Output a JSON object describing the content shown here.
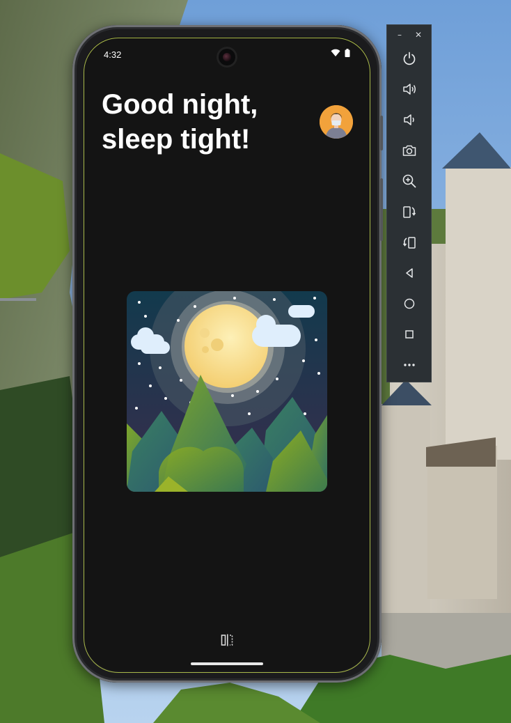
{
  "status_bar": {
    "time": "4:32",
    "icons": [
      "wifi-icon",
      "battery-icon"
    ]
  },
  "app": {
    "headline_line1": "Good night,",
    "headline_line2": "sleep tight!",
    "avatar": "user-avatar",
    "artwork": "night-moon-mountains-illustration"
  },
  "system_nav": {
    "icons": [
      "split-screen-icon"
    ]
  },
  "emulator_toolbar": {
    "minimize_label": "–",
    "close_label": "✕",
    "buttons": [
      "power-icon",
      "volume-up-icon",
      "volume-down-icon",
      "camera-icon",
      "zoom-icon",
      "rotate-left-icon",
      "rotate-right-icon",
      "back-icon",
      "home-icon",
      "overview-icon",
      "more-icon"
    ]
  },
  "colors": {
    "screen_background": "#141414",
    "headline_text": "#ffffff",
    "avatar_background": "#f2a23b",
    "toolbar_background": "#2b3034",
    "moon": "#f9e09a",
    "sky_top": "#123a4d",
    "sky_bottom": "#3a2d4d"
  }
}
